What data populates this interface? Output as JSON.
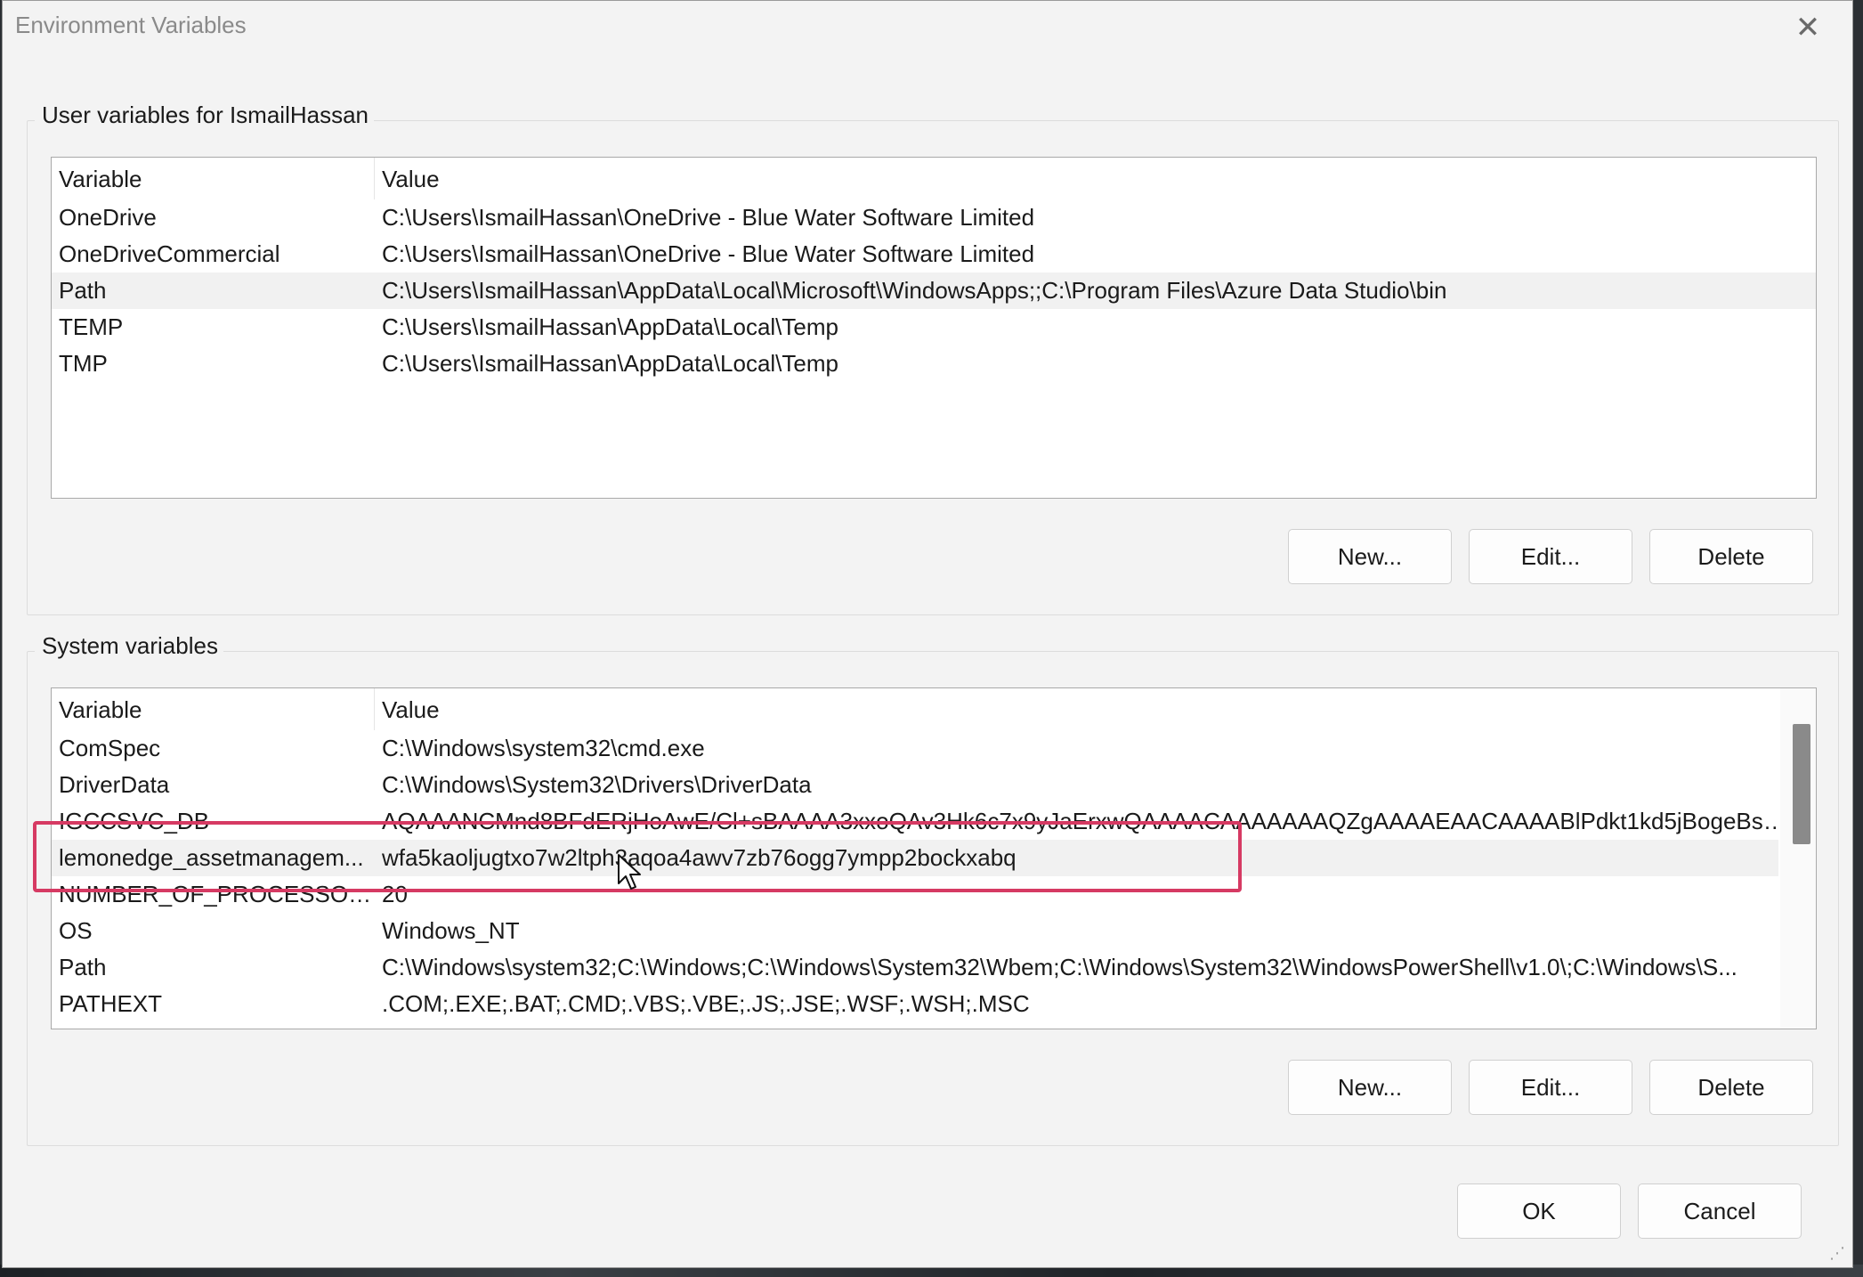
{
  "window": {
    "title": "Environment Variables"
  },
  "user_section": {
    "label": "User variables for IsmailHassan",
    "columns": [
      "Variable",
      "Value"
    ],
    "rows": [
      {
        "variable": "OneDrive",
        "value": "C:\\Users\\IsmailHassan\\OneDrive - Blue Water Software Limited"
      },
      {
        "variable": "OneDriveCommercial",
        "value": "C:\\Users\\IsmailHassan\\OneDrive - Blue Water Software Limited"
      },
      {
        "variable": "Path",
        "value": "C:\\Users\\IsmailHassan\\AppData\\Local\\Microsoft\\WindowsApps;;C:\\Program Files\\Azure Data Studio\\bin"
      },
      {
        "variable": "TEMP",
        "value": "C:\\Users\\IsmailHassan\\AppData\\Local\\Temp"
      },
      {
        "variable": "TMP",
        "value": "C:\\Users\\IsmailHassan\\AppData\\Local\\Temp"
      }
    ],
    "selected_row": "Path",
    "buttons": {
      "new": "New...",
      "edit": "Edit...",
      "delete": "Delete"
    }
  },
  "system_section": {
    "label": "System variables",
    "columns": [
      "Variable",
      "Value"
    ],
    "rows": [
      {
        "variable": "ComSpec",
        "value": "C:\\Windows\\system32\\cmd.exe"
      },
      {
        "variable": "DriverData",
        "value": "C:\\Windows\\System32\\Drivers\\DriverData"
      },
      {
        "variable": "IGCCSVC_DB",
        "value": "AQAAANCMnd8BFdERjHoAwE/Cl+sBAAAA3xxoQAv3Hk6c7x9yJaErxwQAAAACAAAAAAAQZgAAAAEAACAAAABlPdkt1kd5jBogeBsk..."
      },
      {
        "variable": "lemonedge_assetmanagem...",
        "value": "wfa5kaoljugtxo7w2ltph3aqoa4awv7zb76ogg7ympp2bockxabq"
      },
      {
        "variable": "NUMBER_OF_PROCESSORS",
        "value": "20"
      },
      {
        "variable": "OS",
        "value": "Windows_NT"
      },
      {
        "variable": "Path",
        "value": "C:\\Windows\\system32;C:\\Windows;C:\\Windows\\System32\\Wbem;C:\\Windows\\System32\\WindowsPowerShell\\v1.0\\;C:\\Windows\\S..."
      },
      {
        "variable": "PATHEXT",
        "value": ".COM;.EXE;.BAT;.CMD;.VBS;.VBE;.JS;.JSE;.WSF;.WSH;.MSC"
      }
    ],
    "selected_row": "lemonedge_assetmanagem...",
    "buttons": {
      "new": "New...",
      "edit": "Edit...",
      "delete": "Delete"
    }
  },
  "footer": {
    "ok": "OK",
    "cancel": "Cancel"
  },
  "colors": {
    "highlight_box": "#d63a63",
    "selected_row": "#f1f1f1",
    "dialog_bg": "#f3f3f3"
  },
  "icons": [
    "close-icon",
    "mouse-cursor-icon",
    "resize-grip-icon"
  ]
}
